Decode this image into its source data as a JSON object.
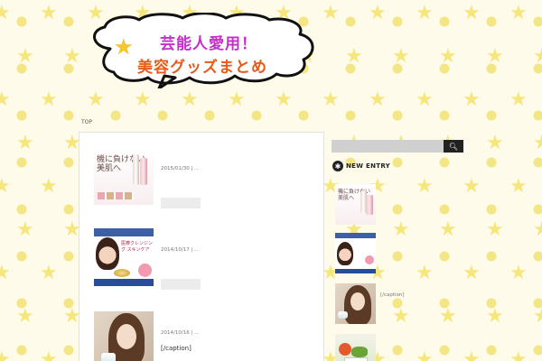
{
  "header": {
    "title_line1": "芸能人愛用！",
    "title_line2": "美容グッズまとめ",
    "logo_colors": {
      "line1": "#c230c8",
      "line2": "#e85a1a",
      "star": "#f7c62a"
    }
  },
  "breadcrumb": {
    "top_label": "TOP"
  },
  "posts": [
    {
      "date": "2015/01/30 | ...",
      "thumb_text": "機に負けない 美肌へ",
      "title": ""
    },
    {
      "date": "2014/10/17 | ...",
      "thumb_text": "医療クレンジング スキンケア",
      "title": ""
    },
    {
      "date": "2014/10/16 | ...",
      "thumb_text": "",
      "title": "[/caption]"
    }
  ],
  "sidebar": {
    "search": {
      "placeholder": "",
      "button_icon": "search-icon"
    },
    "new_entry": {
      "heading": "NEW ENTRY",
      "icon": "badge-star-icon"
    },
    "items": [
      {
        "caption": ""
      },
      {
        "caption": ""
      },
      {
        "caption": "[/caption]"
      },
      {
        "caption": ""
      }
    ]
  }
}
